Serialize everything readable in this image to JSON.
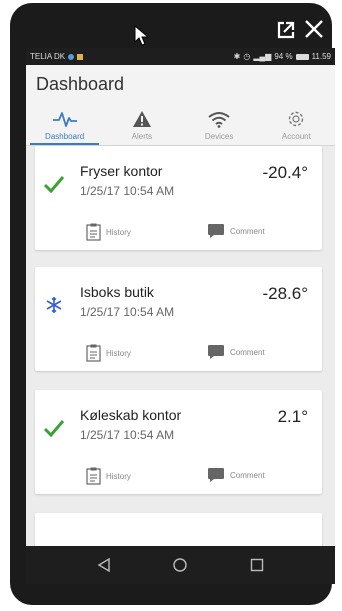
{
  "window": {
    "open_external_icon": "open-external-icon",
    "close_icon": "close-icon"
  },
  "statusbar": {
    "carrier": "TELIA DK",
    "battery": "94 %",
    "time": "11.59"
  },
  "app": {
    "title": "Dashboard",
    "accent_color": "#3b7bc4",
    "ok_color": "#3aa335",
    "frost_color": "#2f5fd0"
  },
  "tabs": [
    {
      "label": "Dashboard",
      "icon": "pulse-icon",
      "active": true
    },
    {
      "label": "Alerts",
      "icon": "warning-icon",
      "active": false
    },
    {
      "label": "Devices",
      "icon": "wifi-icon",
      "active": false
    },
    {
      "label": "Account",
      "icon": "gear-icon",
      "active": false
    }
  ],
  "cards": [
    {
      "name": "Fryser kontor",
      "time": "1/25/17 10:54 AM",
      "temp": "-20.4°",
      "status": "check",
      "history": "History",
      "comment": "Comment"
    },
    {
      "name": "Isboks butik",
      "time": "1/25/17 10:54 AM",
      "temp": "-28.6°",
      "status": "snowflake",
      "history": "History",
      "comment": "Comment"
    },
    {
      "name": "Køleskab kontor",
      "time": "1/25/17 10:54 AM",
      "temp": "2.1°",
      "status": "check",
      "history": "History",
      "comment": "Comment"
    }
  ]
}
